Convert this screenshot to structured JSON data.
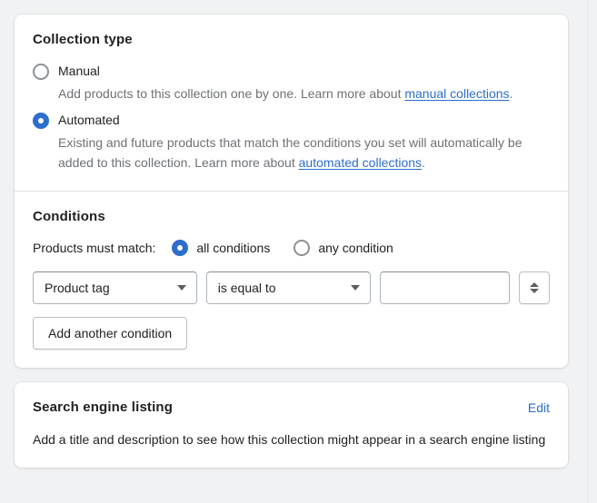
{
  "collection_type": {
    "heading": "Collection type",
    "options": [
      {
        "id": "manual",
        "label": "Manual",
        "selected": false,
        "help_before": "Add products to this collection one by one. Learn more about ",
        "help_link": "manual collections",
        "help_after": "."
      },
      {
        "id": "automated",
        "label": "Automated",
        "selected": true,
        "help_before": "Existing and future products that match the conditions you set will automatically be added to this collection. Learn more about ",
        "help_link": "automated collections",
        "help_after": "."
      }
    ]
  },
  "conditions": {
    "heading": "Conditions",
    "match_label": "Products must match:",
    "match_options": [
      {
        "id": "all",
        "label": "all conditions",
        "selected": true
      },
      {
        "id": "any",
        "label": "any condition",
        "selected": false
      }
    ],
    "row": {
      "field_value": "Product tag",
      "operator_value": "is equal to",
      "value_text": "",
      "value_placeholder": "",
      "stepper_label": "stepper"
    },
    "add_condition_label": "Add another condition"
  },
  "search_engine_listing": {
    "heading": "Search engine listing",
    "edit_label": "Edit",
    "description": "Add a title and description to see how this collection might appear in a search engine listing"
  },
  "colors": {
    "accent": "#2c6ecb",
    "page_bg": "#f1f2f3",
    "card_bg": "#ffffff",
    "text": "#202223",
    "subdued_text": "#6d7175",
    "border": "#e1e3e5"
  }
}
